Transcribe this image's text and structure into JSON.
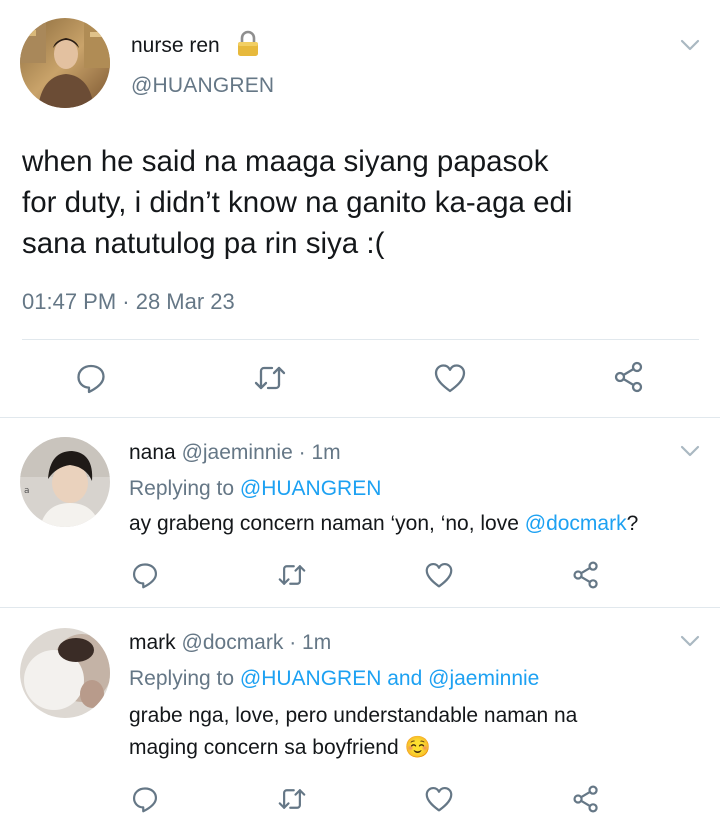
{
  "main_tweet": {
    "display_name": "nurse ren",
    "lock_icon": "padlock",
    "handle": "@HUANGREN",
    "text_lines": [
      "when he said na maaga siyang papasok",
      "for duty, i didn’t know na ganito ka-aga edi",
      "sana natutulog pa rin siya :("
    ],
    "timestamp": "01:47 PM · 28 Mar 23"
  },
  "replies": [
    {
      "display_name": "nana",
      "handle": "@jaeminnie",
      "age": "· 1m",
      "replying_prefix": "Replying to",
      "replying_to": [
        "@HUANGREN"
      ],
      "replying_joiner": "",
      "text_before": "ay grabeng concern naman ‘yon, ‘no, love ",
      "text_mention": "@docmark",
      "text_after": "?"
    },
    {
      "display_name": "mark",
      "handle": "@docmark",
      "age": "· 1m",
      "replying_prefix": "Replying to",
      "replying_to": [
        "@HUANGREN",
        "@jaeminnie"
      ],
      "replying_joiner": "and",
      "text_lines": [
        "grabe nga, love, pero understandable naman na",
        "maging concern sa boyfriend"
      ],
      "emoji": "☺️"
    }
  ],
  "icons": {
    "reply": "speech-bubble",
    "retweet": "retweet-arrows",
    "like": "heart-outline",
    "share": "share-nodes",
    "menu": "chevron-down"
  },
  "colors": {
    "text": "#14171a",
    "muted": "#657786",
    "link": "#1da1f2",
    "divider": "#e1e8ed"
  }
}
